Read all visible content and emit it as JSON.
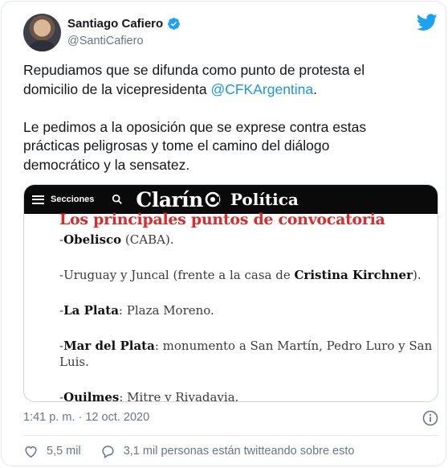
{
  "author": {
    "display_name": "Santiago Cafiero",
    "handle": "@SantiCafiero"
  },
  "tweet": {
    "line1": "Repudiamos que se difunda como punto de protesta el",
    "line2_before": "domicilio de la vicepresidenta ",
    "mention": "@CFKArgentina",
    "line2_after": ".",
    "para2_line1": "Le pedimos a la oposición que se exprese contra estas",
    "para2_line2": "prácticas peligrosas y tome el camino del diálogo",
    "para2_line3": "democrático y la sensatez."
  },
  "media": {
    "header": {
      "sections_label": "Secciones",
      "logo_text": "Clarín",
      "section_name": "Política"
    },
    "title": "Los principales puntos de convocatoria",
    "points": [
      {
        "bold": "",
        "prefix": "-",
        "bold_text": "Obelisco",
        "rest": " (CABA)."
      },
      {
        "prefix": "-Uruguay y Juncal (frente a la casa de ",
        "bold_text": "Cristina Kirchner",
        "rest": ")."
      },
      {
        "prefix": "-",
        "bold_text": "La Plata",
        "rest": ": Plaza Moreno."
      },
      {
        "prefix": "-",
        "bold_text": "Mar del Plata",
        "rest": ": monumento a San Martín, Pedro Luro y San Luis."
      },
      {
        "prefix": "-",
        "bold_text": "Quilmes",
        "rest": ": Mitre y Rivadavia."
      }
    ]
  },
  "footer": {
    "timestamp": "1:41 p. m. · 12 oct. 2020",
    "likes": "5,5 mil",
    "talking": "3,1 mil personas están twitteando sobre esto"
  },
  "colors": {
    "verified_blue": "#1da1f2",
    "mention_blue": "#1b95e0",
    "headline_red": "#d92b2b",
    "secondary_text": "#657786"
  },
  "icons": [
    "verified-badge-icon",
    "twitter-bird-icon",
    "hamburger-menu-icon",
    "search-icon",
    "clarin-logo-icon",
    "info-icon",
    "heart-icon",
    "speech-bubble-icon"
  ]
}
